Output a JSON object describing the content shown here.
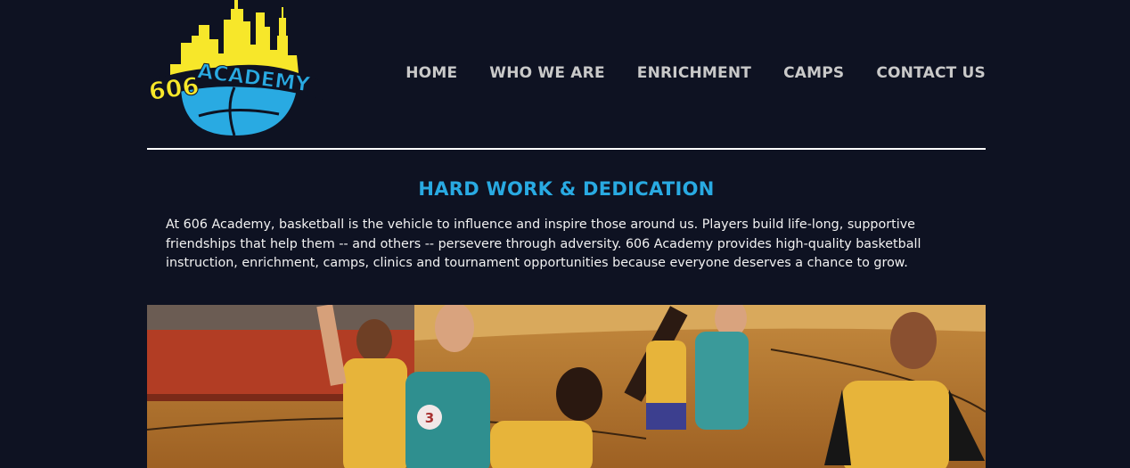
{
  "brand": {
    "logo_text": "606 ACADEMY",
    "colors": {
      "yellow": "#f7e72a",
      "blue": "#29aae2",
      "background": "#0e1222"
    }
  },
  "nav": {
    "items": [
      {
        "label": "HOME"
      },
      {
        "label": "WHO WE ARE"
      },
      {
        "label": "ENRICHMENT"
      },
      {
        "label": "CAMPS"
      },
      {
        "label": "CONTACT US"
      }
    ]
  },
  "main": {
    "headline": "HARD WORK & DEDICATION",
    "intro": "At 606 Academy, basketball is the vehicle to influence and inspire those around us. Players build life-long, supportive friendships that help them -- and others -- persevere through adversity. 606 Academy provides high-quality basketball instruction, enrichment, camps, clinics and tournament opportunities because everyone deserves a chance to grow."
  },
  "hero": {
    "jersey_number": "3"
  }
}
